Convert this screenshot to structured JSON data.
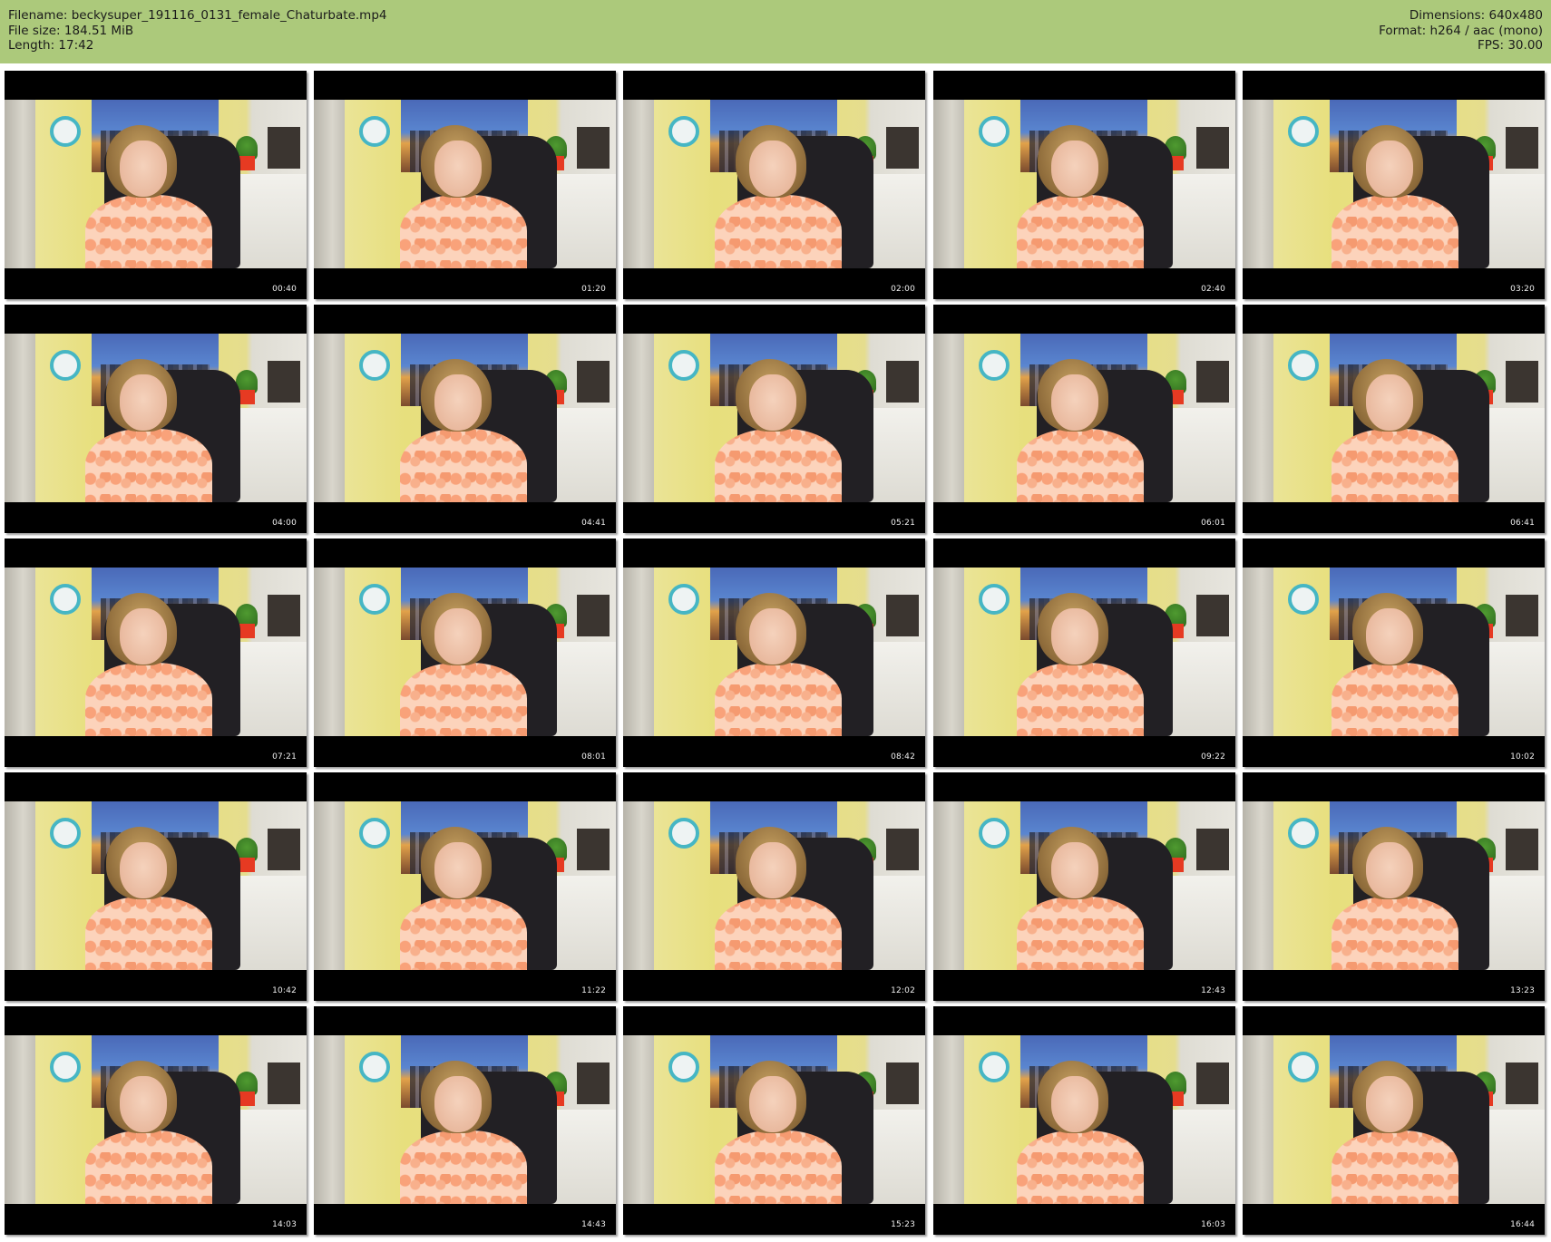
{
  "header": {
    "filename_line": "Filename: beckysuper_191116_0131_female_Chaturbate.mp4",
    "filesize_line": "File size: 184.51 MiB",
    "length_line": "Length: 17:42",
    "dimensions_line": "Dimensions: 640x480",
    "format_line": "Format: h264 / aac (mono)",
    "fps_line": "FPS: 30.00",
    "background_color": "#acc97b"
  },
  "thumbnails": [
    {
      "time": "00:40"
    },
    {
      "time": "01:20"
    },
    {
      "time": "02:00"
    },
    {
      "time": "02:40"
    },
    {
      "time": "03:20"
    },
    {
      "time": "04:00"
    },
    {
      "time": "04:41"
    },
    {
      "time": "05:21"
    },
    {
      "time": "06:01"
    },
    {
      "time": "06:41"
    },
    {
      "time": "07:21"
    },
    {
      "time": "08:01"
    },
    {
      "time": "08:42"
    },
    {
      "time": "09:22"
    },
    {
      "time": "10:02"
    },
    {
      "time": "10:42"
    },
    {
      "time": "11:22"
    },
    {
      "time": "12:02"
    },
    {
      "time": "12:43"
    },
    {
      "time": "13:23"
    },
    {
      "time": "14:03"
    },
    {
      "time": "14:43"
    },
    {
      "time": "15:23"
    },
    {
      "time": "16:03"
    },
    {
      "time": "16:44"
    }
  ]
}
